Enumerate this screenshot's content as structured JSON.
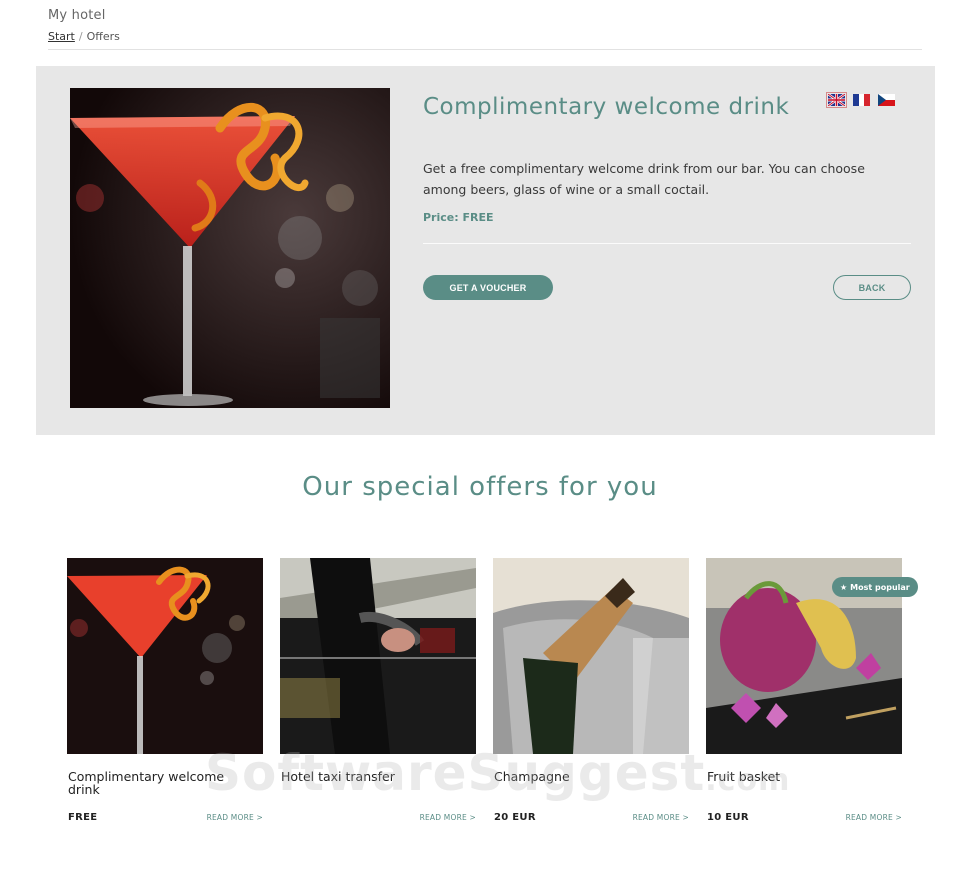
{
  "header": {
    "site_title": "My hotel",
    "breadcrumb": {
      "start": "Start",
      "separator": "/",
      "current": "Offers"
    }
  },
  "offer": {
    "title": "Complimentary welcome drink",
    "description": "Get a free complimentary welcome drink from our bar. You can choose among beers, glass of wine or a small coctail.",
    "price": "Price: FREE",
    "voucher_label": "GET A VOUCHER",
    "back_label": "BACK",
    "languages": [
      "en-flag-icon",
      "fr-flag-icon",
      "cz-flag-icon"
    ]
  },
  "section": {
    "title": "Our special offers for you"
  },
  "cards": [
    {
      "name": "Complimentary welcome drink",
      "price": "FREE",
      "more": "READ MORE >",
      "image": "cocktail"
    },
    {
      "name": "Hotel taxi transfer",
      "price": "",
      "more": "READ MORE >",
      "image": "car-door"
    },
    {
      "name": "Champagne",
      "price": "20 EUR",
      "more": "READ MORE >",
      "image": "champagne"
    },
    {
      "name": "Fruit basket",
      "price": "10 EUR",
      "more": "READ MORE >",
      "image": "fruit",
      "badge": "Most popular"
    }
  ],
  "watermark": {
    "main": "SoftwareSuggest",
    "suffix": ".com"
  },
  "colors": {
    "accent": "#5a8d86",
    "panel": "#e7e7e7"
  }
}
